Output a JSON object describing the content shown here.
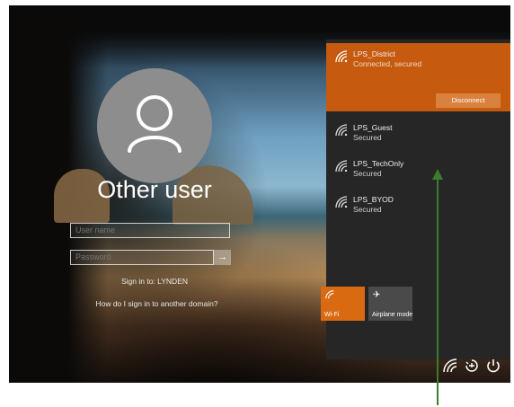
{
  "login": {
    "user_title": "Other user",
    "username_placeholder": "User name",
    "password_placeholder": "Password",
    "sign_in_to": "Sign in to: LYNDEN",
    "domain_link": "How do I sign in to another domain?"
  },
  "network_panel": {
    "active": {
      "name": "LPS_District",
      "status": "Connected, secured",
      "disconnect_label": "Disconnect"
    },
    "networks": [
      {
        "name": "LPS_Guest",
        "status": "Secured"
      },
      {
        "name": "LPS_TechOnly",
        "status": "Secured"
      },
      {
        "name": "LPS_BYOD",
        "status": "Secured"
      }
    ],
    "tiles": {
      "wifi_label": "Wi-Fi",
      "airplane_label": "Airplane mode"
    }
  },
  "colors": {
    "accent": "#c65a0e",
    "tile_on": "#d96a12",
    "panel_bg": "#262626",
    "annotation_arrow": "#3a7d2c"
  },
  "icons": [
    "user-icon",
    "arrow-right-icon",
    "wifi-icon",
    "airplane-icon",
    "ease-of-access-icon",
    "power-icon"
  ]
}
